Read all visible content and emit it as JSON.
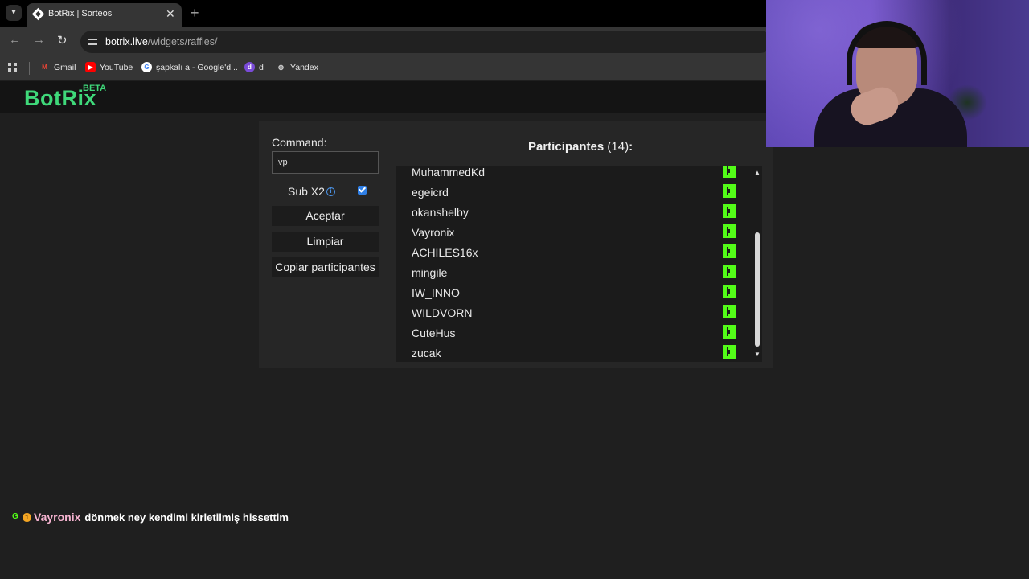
{
  "browser": {
    "tab_title": "BotRix | Sorteos",
    "new_tab": "+",
    "close_tab": "✕",
    "url_domain": "botrix.live",
    "url_path": "/widgets/raffles/",
    "nav": {
      "back": "←",
      "forward": "→",
      "reload": "↻"
    },
    "bookmarks": [
      {
        "label": "Gmail",
        "icon": "gmail-icon",
        "glyph": "M",
        "color": "#ea4335"
      },
      {
        "label": "YouTube",
        "icon": "youtube-icon",
        "glyph": "▶",
        "color": "#ff0000"
      },
      {
        "label": "şapkalı a - Google'd...",
        "icon": "google-icon",
        "glyph": "G",
        "color": "#ffffff"
      },
      {
        "label": "d",
        "icon": "d-bookmark-icon",
        "glyph": "d",
        "color": "#7a4bd8"
      },
      {
        "label": "Yandex",
        "icon": "globe-icon",
        "glyph": "◍",
        "color": "#cccccc"
      }
    ]
  },
  "app": {
    "logo": "BotRix",
    "beta": "BETA",
    "accent": "#3fd97a"
  },
  "raffle": {
    "command_label": "Command:",
    "command_value": "!vp",
    "sub_label": "Sub X2",
    "sub_checked": true,
    "accept_label": "Aceptar",
    "clear_label": "Limpiar",
    "copy_label": "Copiar participantes",
    "participants_label": "Participantes",
    "participants_count": "(14)",
    "participants_colon": ":",
    "participants": [
      "MuhammedKd",
      "egeicrd",
      "okanshelby",
      "Vayronix",
      "ACHILES16x",
      "mingile",
      "IW_INNO",
      "WILDVORN",
      "CuteHus",
      "zucak"
    ],
    "kick_color": "#53fc18"
  },
  "chat": {
    "badge_g": "G",
    "badge_sub": "1",
    "user": "Vayronix",
    "message": "dönmek ney kendimi kirletilmiş hissettim"
  }
}
